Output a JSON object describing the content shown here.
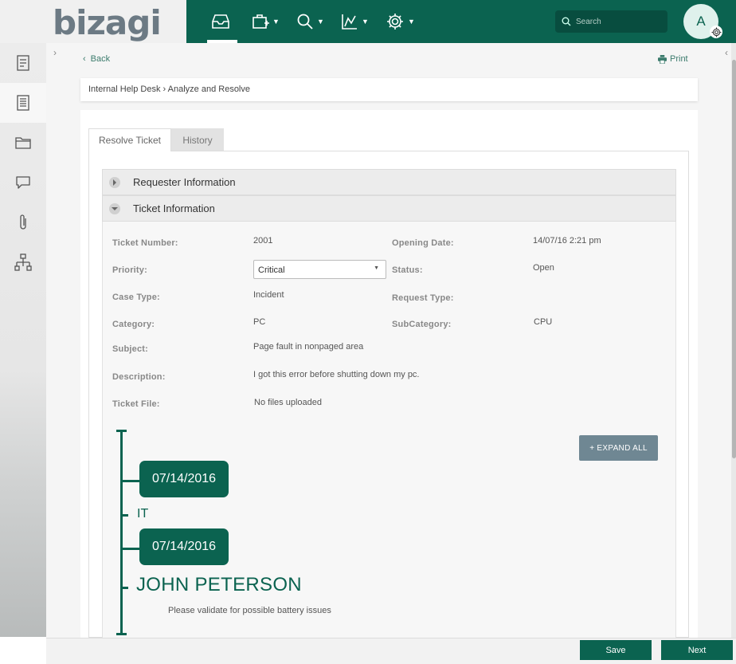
{
  "brand": {
    "logo_text": "bizagi",
    "primary_color": "#0b6350",
    "accent_gray": "#6f8793"
  },
  "topbar": {
    "icons": [
      "inbox-icon",
      "new-case-icon",
      "search-menu-icon",
      "analytics-icon",
      "admin-gear-icon"
    ],
    "search_placeholder": "Search",
    "avatar_initial": "A"
  },
  "sidebar": {
    "items": [
      "task-list-icon",
      "case-list-icon",
      "folder-icon",
      "chat-icon",
      "attachment-icon",
      "process-map-icon"
    ]
  },
  "nav": {
    "back_label": "Back",
    "print_label": "Print"
  },
  "breadcrumb": "Internal Help Desk › Analyze and Resolve",
  "tabs": [
    {
      "label": "Resolve Ticket",
      "active": true
    },
    {
      "label": "History",
      "active": false
    }
  ],
  "sections": {
    "requester": "Requester Information",
    "ticket": "Ticket Information"
  },
  "fields": {
    "ticket_number": {
      "label": "Ticket Number:",
      "value": "2001"
    },
    "opening_date": {
      "label": "Opening Date:",
      "value": "14/07/16 2:21 pm"
    },
    "priority": {
      "label": "Priority:",
      "value": "Critical"
    },
    "status": {
      "label": "Status:",
      "value": "Open"
    },
    "case_type": {
      "label": "Case Type:",
      "value": "Incident"
    },
    "request_type": {
      "label": "Request Type:",
      "value": ""
    },
    "category": {
      "label": "Category:",
      "value": "PC"
    },
    "subcategory": {
      "label": "SubCategory:",
      "value": "CPU"
    },
    "subject": {
      "label": "Subject:",
      "value": "Page fault in nonpaged area"
    },
    "description": {
      "label": "Description:",
      "value": "I got this error before shutting down my pc."
    },
    "ticket_file": {
      "label": "Ticket File:",
      "value": "No files uploaded"
    }
  },
  "timeline": {
    "expand_all_label": "+ EXPAND ALL",
    "date_1": "07/14/2016",
    "group_1": "IT",
    "date_2": "07/14/2016",
    "author": "JOHN PETERSON",
    "comment": "Please validate for possible battery issues"
  },
  "actions": {
    "save_label": "Save",
    "next_label": "Next"
  }
}
